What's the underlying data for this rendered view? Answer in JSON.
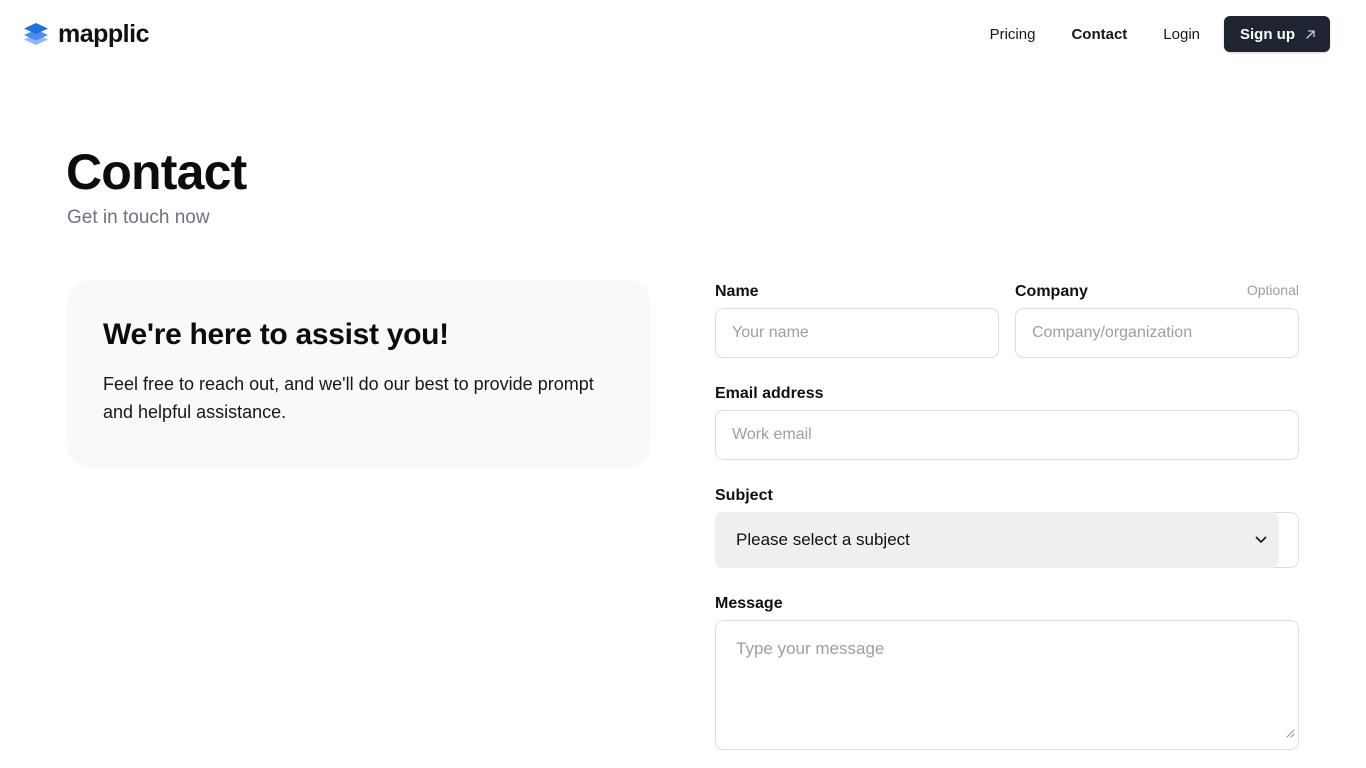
{
  "brand": {
    "name": "mapplic",
    "logo_icon": "layers-icon",
    "logo_colors": [
      "#1f6fe0",
      "#4a8cf0",
      "#8cb8f7"
    ]
  },
  "nav": {
    "links": [
      {
        "label": "Pricing"
      },
      {
        "label": "Contact"
      },
      {
        "label": "Login"
      }
    ],
    "signup_label": "Sign up",
    "signup_icon": "arrow-up-right-icon",
    "signup_color": "#1e2431"
  },
  "page": {
    "title": "Contact",
    "subtitle": "Get in touch now"
  },
  "info_card": {
    "title": "We're here to assist you!",
    "text": "Feel free to reach out, and we'll do our best to provide prompt and helpful assistance."
  },
  "form": {
    "name": {
      "label": "Name",
      "placeholder": "Your name",
      "value": ""
    },
    "company": {
      "label": "Company",
      "optional_label": "Optional",
      "placeholder": "Company/organization",
      "value": ""
    },
    "email": {
      "label": "Email address",
      "placeholder": "Work email",
      "value": ""
    },
    "subject": {
      "label": "Subject",
      "selected": "Please select a subject",
      "icon": "chevron-down-icon"
    },
    "message": {
      "label": "Message",
      "placeholder": "Type your message",
      "value": ""
    }
  }
}
